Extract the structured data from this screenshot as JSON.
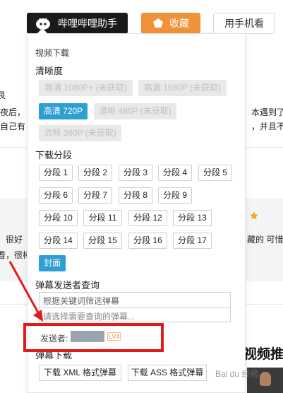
{
  "topbar": {
    "helper_label": "哔哩哔哩助手",
    "favorite_label": "收藏",
    "phone_label": "用手机看"
  },
  "background": {
    "left_frag_1": "艮",
    "left_frag_2": "夜后，",
    "left_frag_3": "自己有",
    "right_frag_1": "本遇到了",
    "right_frag_2": "，并且不",
    "left_frag_4": "。很好",
    "left_frag_5": "看，很棒",
    "right_frag_3": "藏的 可惜",
    "right_title": "视频推荐"
  },
  "panel": {
    "title": "视频下载",
    "quality_heading": "清晰度",
    "quality_options": [
      {
        "label": "高清 1080P+ (未获取)",
        "state": "disabled"
      },
      {
        "label": "高清 1080P (未获取)",
        "state": "disabled"
      },
      {
        "label": "高清 720P",
        "state": "active"
      },
      {
        "label": "清晰 480P (未获取)",
        "state": "disabled"
      },
      {
        "label": "流畅 360P (未获取)",
        "state": "disabled"
      }
    ],
    "segments_heading": "下载分段",
    "segments": [
      "分段 1",
      "分段 2",
      "分段 3",
      "分段 4",
      "分段 5",
      "分段 6",
      "分段 7",
      "分段 8",
      "分段 9",
      "分段 10",
      "分段 11",
      "分段 12",
      "分段 13",
      "分段 14",
      "分段 15",
      "分段 16",
      "分段 17"
    ],
    "cover_label": "封面",
    "danmaku_heading": "弹幕发送者查询",
    "danmaku_filter_placeholder": "根据关键词筛选弹幕",
    "danmaku_select_placeholder": "请选择需要查询的弹幕...",
    "sender_label": "发送者:",
    "sender_level": "LV4",
    "danmaku_download_heading": "弹幕下载",
    "download_xml": "下载 XML 格式弹幕",
    "download_ass": "下载 ASS 格式弹幕"
  },
  "watermark": "Bai du 经验",
  "colors": {
    "accent_blue": "#2e9fd3",
    "favorite_orange": "#f0923a",
    "highlight_red": "#e01b1b",
    "helper_dark": "#1a1a1a"
  }
}
